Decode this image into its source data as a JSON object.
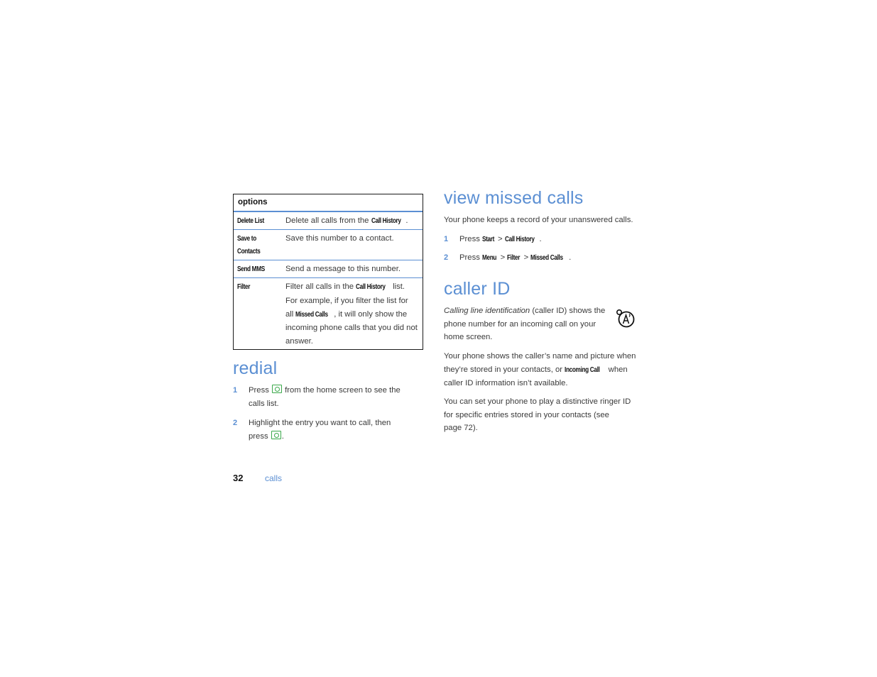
{
  "options_table": {
    "header": "options",
    "rows": [
      {
        "name": "Delete List",
        "desc_parts": [
          "Delete all calls from the ",
          "Call History",
          "."
        ]
      },
      {
        "name_line1": "Save to",
        "name_line2": "Contacts",
        "desc": "Save this number to a contact."
      },
      {
        "name": "Send MMS",
        "desc": "Send a message to this number."
      },
      {
        "name": "Filter",
        "desc_parts": [
          "Filter all calls in the ",
          "Call History",
          " list. For example, if you filter the list for all ",
          "Missed Calls",
          ", it will only show the incoming phone calls that you did not answer."
        ]
      }
    ]
  },
  "redial": {
    "title": "redial",
    "steps": [
      {
        "num": "1",
        "before": "Press ",
        "icon": "call-key-icon",
        "after": " from the home screen to see the",
        "line2": "calls list."
      },
      {
        "num": "2",
        "line1": "Highlight the entry you want to call, then",
        "before": "press ",
        "icon": "call-key-icon",
        "after": "."
      }
    ]
  },
  "view_missed_calls": {
    "title": "view missed calls",
    "intro": "Your phone keeps a record of your unanswered calls.",
    "steps": [
      {
        "num": "1",
        "press": "Press ",
        "path": [
          "Start",
          "Call History"
        ],
        "end": "."
      },
      {
        "num": "2",
        "press": "Press ",
        "path": [
          "Menu",
          "Filter",
          "Missed Calls"
        ],
        "end": "."
      }
    ],
    "separator": " > "
  },
  "caller_id": {
    "title": "caller ID",
    "icon": "network-feature-icon",
    "para1_italic": "Calling line identification",
    "para1_line1_rest": " (caller ID) shows the",
    "para1_line2": "phone number for an incoming call on your",
    "para1_line3": "home screen.",
    "para2_line1": "Your phone shows the caller’s name and picture when",
    "para2_line2_before": "they’re stored in your contacts, or ",
    "para2_line2_kw": "Incoming Call",
    "para2_line2_after": " when",
    "para2_line3": "caller ID information isn’t available.",
    "para3_line1": "You can set your phone to play a distinctive ringer ID",
    "para3_line2": "for specific entries stored in your contacts (see",
    "para3_line3": "page 72)."
  },
  "footer": {
    "page_number": "32",
    "section": "calls"
  },
  "colors": {
    "accent_blue": "#5b8fd3",
    "call_key_green": "#3aa84a",
    "text": "#3a3a3a"
  }
}
